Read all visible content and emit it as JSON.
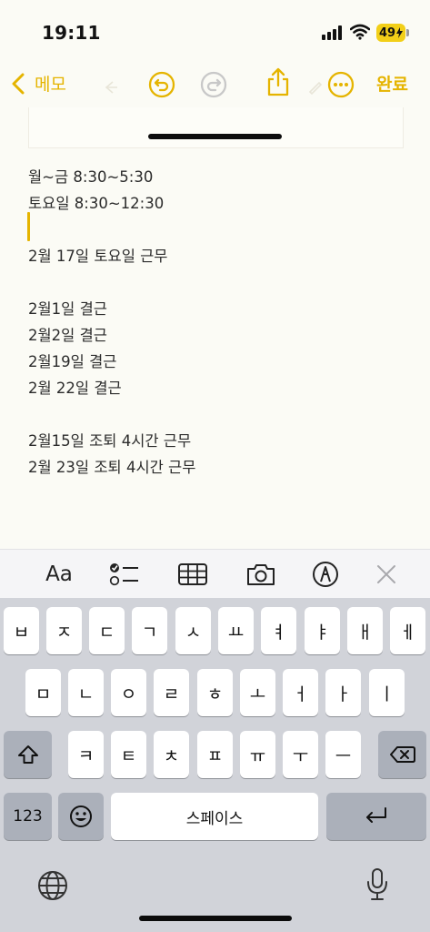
{
  "status_bar": {
    "time": "19:11",
    "battery": "49"
  },
  "toolbar": {
    "back_label": "메모",
    "done_label": "완료",
    "accent_color": "#e5b400"
  },
  "note": {
    "lines": [
      "월~금 8:30~5:30",
      "토요일 8:30~12:30",
      "2월 17일 토요일 근무",
      "2월1일 결근",
      "2월2일 결근",
      "2월19일 결근",
      "2월 22일 결근",
      "2월15일 조퇴 4시간 근무",
      "2월 23일 조퇴 4시간 근무"
    ]
  },
  "format_bar": {
    "text_style_label": "Aa"
  },
  "keyboard": {
    "row1": [
      "ㅂ",
      "ㅈ",
      "ㄷ",
      "ㄱ",
      "ㅅ",
      "ㅛ",
      "ㅕ",
      "ㅑ",
      "ㅐ",
      "ㅔ"
    ],
    "row2": [
      "ㅁ",
      "ㄴ",
      "ㅇ",
      "ㄹ",
      "ㅎ",
      "ㅗ",
      "ㅓ",
      "ㅏ",
      "ㅣ"
    ],
    "row3": [
      "ㅋ",
      "ㅌ",
      "ㅊ",
      "ㅍ",
      "ㅠ",
      "ㅜ",
      "ㅡ"
    ],
    "numbers_label": "123",
    "space_label": "스페이스"
  }
}
